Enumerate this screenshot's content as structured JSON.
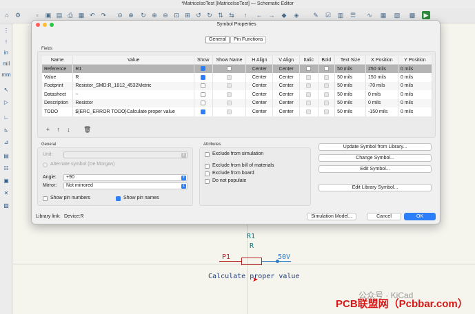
{
  "window": {
    "title": "*MatriceIsoTest [MatriceIsoTest] — Schematic Editor"
  },
  "dialog": {
    "title": "Symbol Properties",
    "tabs": [
      {
        "label": "General"
      },
      {
        "label": "Pin Functions"
      }
    ],
    "fields_label": "Fields",
    "columns": [
      "Name",
      "Value",
      "Show",
      "Show Name",
      "H Align",
      "V Align",
      "Italic",
      "Bold",
      "Text Size",
      "X Position",
      "Y Position"
    ],
    "rows": [
      {
        "name": "Reference",
        "value": "R1",
        "h": "Center",
        "v": "Center",
        "size": "50 mils",
        "x": "250 mils",
        "y": "0 mils"
      },
      {
        "name": "Value",
        "value": "R",
        "h": "Center",
        "v": "Center",
        "size": "50 mils",
        "x": "150 mils",
        "y": "0 mils"
      },
      {
        "name": "Footprint",
        "value": "Resistor_SMD:R_1812_4532Metric",
        "h": "Center",
        "v": "Center",
        "size": "50 mils",
        "x": "-70 mils",
        "y": "0 mils"
      },
      {
        "name": "Datasheet",
        "value": "~",
        "h": "Center",
        "v": "Center",
        "size": "50 mils",
        "x": "0 mils",
        "y": "0 mils"
      },
      {
        "name": "Description",
        "value": "Resistor",
        "h": "Center",
        "v": "Center",
        "size": "50 mils",
        "x": "0 mils",
        "y": "0 mils"
      },
      {
        "name": "TODO",
        "value": "${ERC_ERROR TODO}Calculate proper value",
        "h": "Center",
        "v": "Center",
        "size": "50 mils",
        "x": "-150 mils",
        "y": "0 mils"
      }
    ],
    "general": {
      "label": "General",
      "unit_label": "Unit:",
      "alternate_label": "Alternate symbol (De Morgan)",
      "angle_label": "Angle:",
      "angle_value": "+90",
      "mirror_label": "Mirror:",
      "mirror_value": "Not mirrored",
      "show_pin_numbers": "Show pin numbers",
      "show_pin_names": "Show pin names"
    },
    "attributes": {
      "label": "Attributes",
      "exclude_sim": "Exclude from simulation",
      "exclude_bom": "Exclude from bill of materials",
      "exclude_board": "Exclude from board",
      "do_not_populate": "Do not populate"
    },
    "buttons": {
      "update_symbol": "Update Symbol from Library...",
      "change_symbol": "Change Symbol...",
      "edit_symbol": "Edit Symbol...",
      "edit_library_symbol": "Edit Library Symbol...",
      "simulation_model": "Simulation Model...",
      "cancel": "Cancel",
      "ok": "OK"
    },
    "library_link_label": "Library link:",
    "library_link_value": "Device:R"
  },
  "schematic": {
    "ref": "R1",
    "value": "R",
    "net_left": "P1",
    "net_right": "50V",
    "todo_text": "Calculate proper value"
  },
  "watermark": {
    "wechat": "公众号 · KiCad",
    "site": "PCB联盟网（Pcbbar.com）"
  },
  "colors": {
    "accent": "#2d7ff9",
    "selection": "#b4b4b4",
    "schematic_text": "#1f3c78",
    "pin_red": "#b51f1f",
    "power_blue": "#2a7bc4"
  }
}
